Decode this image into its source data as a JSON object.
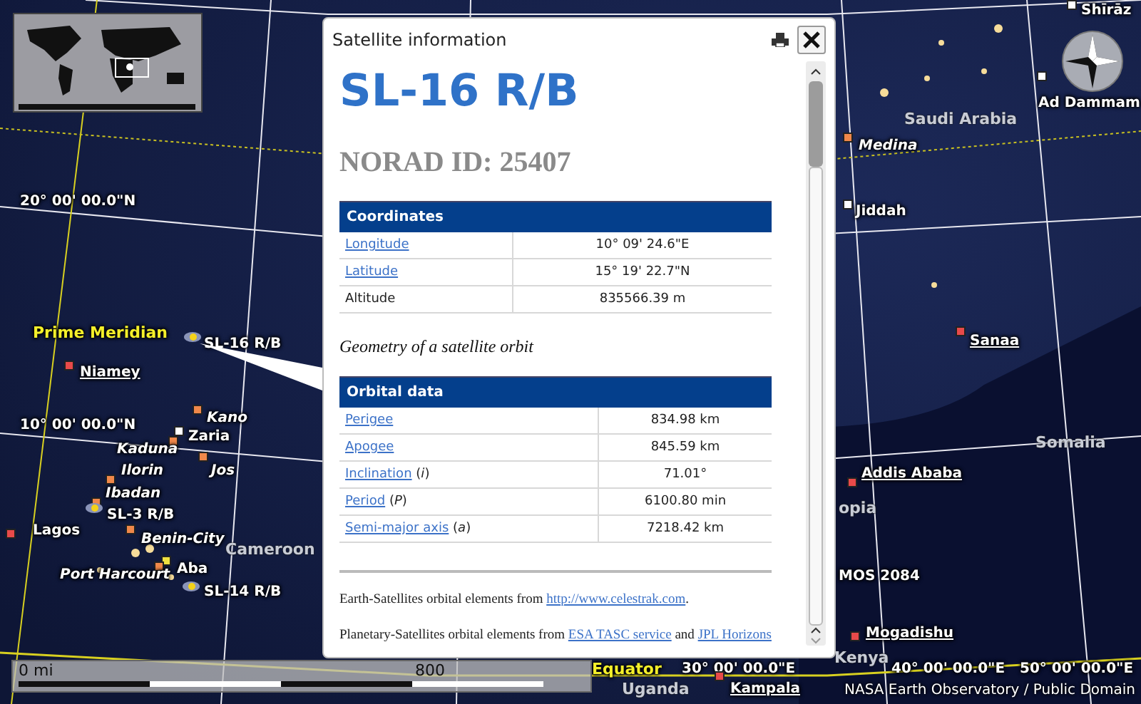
{
  "map": {
    "labels": [
      {
        "kind": "town",
        "text": "Shīrāz",
        "color": "#ffffff"
      },
      {
        "kind": "town",
        "text": "Ad Dammam",
        "color": "#ffffff"
      },
      {
        "kind": "country",
        "text": "Saudi Arabia"
      },
      {
        "kind": "city",
        "text": "Medina",
        "color": "#f0884a"
      },
      {
        "kind": "grid",
        "text": "20° 00' 00.0\"N"
      },
      {
        "kind": "town",
        "text": "Jiddah",
        "color": "#ffffff"
      },
      {
        "kind": "line",
        "text": "Prime Meridian"
      },
      {
        "kind": "capital",
        "text": "Sanaa",
        "color": "#e84a4a"
      },
      {
        "kind": "satellite",
        "text": "SL-16 R/B"
      },
      {
        "kind": "capital",
        "text": "Niamey",
        "color": "#e84a4a"
      },
      {
        "kind": "city",
        "text": "Kano",
        "color": "#f0884a"
      },
      {
        "kind": "grid",
        "text": "10° 00' 00.0\"N"
      },
      {
        "kind": "town",
        "text": "Zaria",
        "color": "#ffffff"
      },
      {
        "kind": "country",
        "text": "Somalia"
      },
      {
        "kind": "city",
        "text": "Kaduna",
        "color": "#f0884a"
      },
      {
        "kind": "city",
        "text": "Ilorin",
        "color": "#f0884a"
      },
      {
        "kind": "city",
        "text": "Jos",
        "color": "#f0884a"
      },
      {
        "kind": "capital",
        "text": "Addis Ababa",
        "color": "#e84a4a"
      },
      {
        "kind": "city",
        "text": "Ibadan",
        "color": "#f0884a"
      },
      {
        "kind": "country",
        "text": "opia"
      },
      {
        "kind": "satellite",
        "text": "SL-3 R/B"
      },
      {
        "kind": "town",
        "text": "Lagos",
        "color": "#e84a4a"
      },
      {
        "kind": "city",
        "text": "Benin-City",
        "color": "#f0884a"
      },
      {
        "kind": "country",
        "text": "Cameroon"
      },
      {
        "kind": "town",
        "text": "Aba",
        "color": "#f0e040"
      },
      {
        "kind": "city",
        "text": "Port Harcourt",
        "color": "#f0884a"
      },
      {
        "kind": "plain",
        "text": "MOS 2084"
      },
      {
        "kind": "satellite",
        "text": "SL-14 R/B"
      },
      {
        "kind": "capital",
        "text": "Mogadishu",
        "color": "#e84a4a"
      },
      {
        "kind": "country",
        "text": "Kenya"
      },
      {
        "kind": "line",
        "text": "Equator"
      },
      {
        "kind": "grid",
        "text": "30° 00' 00.0\"E"
      },
      {
        "kind": "grid",
        "text": "40° 00' 00.0\"E"
      },
      {
        "kind": "grid",
        "text": "50° 00' 00.0\"E"
      },
      {
        "kind": "country",
        "text": "Uganda"
      },
      {
        "kind": "capital",
        "text": "Kampala",
        "color": "#e84a4a"
      }
    ],
    "scale": {
      "start": "0 mi",
      "end": "800"
    },
    "attribution": "NASA Earth Observatory / Public Domain"
  },
  "dialog": {
    "title": "Satellite information",
    "name": "SL-16 R/B",
    "norad": "NORAD ID: 25407",
    "coordinates": {
      "heading": "Coordinates",
      "rows": [
        {
          "label": "Longitude",
          "link": true,
          "value": "10° 09' 24.6\"E"
        },
        {
          "label": "Latitude",
          "link": true,
          "value": "15° 19' 22.7\"N"
        },
        {
          "label": "Altitude",
          "link": false,
          "value": "835566.39 m"
        }
      ]
    },
    "caption": "Geometry of a satellite orbit",
    "orbital": {
      "heading": "Orbital data",
      "rows": [
        {
          "label": "Perigee",
          "link": true,
          "value": "834.98 km"
        },
        {
          "label": "Apogee",
          "link": true,
          "value": "845.59 km"
        },
        {
          "label": "Inclination",
          "link": true,
          "note": "(*i*)",
          "value": "71.01°"
        },
        {
          "label": "Period",
          "link": true,
          "note": "(*P*)",
          "value": "6100.80 min"
        },
        {
          "label": "Semi-major axis",
          "link": true,
          "note": "(*a*)",
          "value": "7218.42 km"
        }
      ]
    },
    "footer": [
      [
        {
          "kind": "text",
          "text": "Earth-Satellites orbital elements from "
        },
        {
          "kind": "link",
          "text": "http://www.celestrak.com"
        },
        {
          "kind": "text",
          "text": "."
        }
      ],
      [
        {
          "kind": "text",
          "text": "Planetary-Satellites orbital elements from "
        },
        {
          "kind": "link",
          "text": "ESA TASC service"
        },
        {
          "kind": "text",
          "text": " and "
        },
        {
          "kind": "link",
          "text": "JPL Horizons"
        }
      ]
    ]
  }
}
